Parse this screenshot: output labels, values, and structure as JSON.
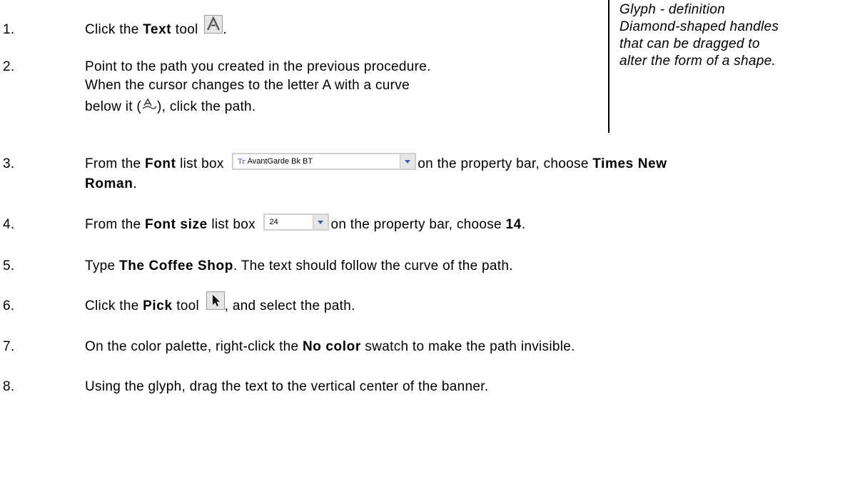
{
  "sidebar": {
    "line1": "Glyph - definition",
    "line2": "Diamond-shaped handles",
    "line3": "that can be dragged to",
    "line4": "alter the form of a shape."
  },
  "steps": [
    {
      "num": "1.",
      "pre": "Click the ",
      "bold": "Text",
      "post": " tool",
      "end": "."
    },
    {
      "num": "2.",
      "line1": "Point to the path you created in the previous procedure.",
      "line2": "When the cursor changes to the letter A with a curve",
      "line3_pre": "below it (",
      "line3_post": "), click the path."
    },
    {
      "num": "3.",
      "pre": "From the ",
      "bold": "Font",
      "mid": " list box",
      "post": "on the property bar, choose ",
      "bold2": "Times New",
      "bold3": "Roman",
      "end": "."
    },
    {
      "num": "4.",
      "pre": "From the ",
      "bold": "Font size",
      "mid": " list box",
      "post": "on the property bar, choose ",
      "bold2": "14",
      "end": "."
    },
    {
      "num": "5.",
      "pre": "Type ",
      "bold": "The Coffee Shop",
      "post": ". The text should follow the curve of the path."
    },
    {
      "num": "6.",
      "pre": "Click the ",
      "bold": "Pick",
      "post": " tool",
      "end": ", and select the path."
    },
    {
      "num": "7.",
      "pre": "On the color palette, right-click the ",
      "bold": "No color",
      "post": " swatch to make the path invisible."
    },
    {
      "num": "8.",
      "text": "Using the glyph, drag the text to the vertical center of the banner."
    }
  ],
  "font_combo": {
    "value": "AvantGarde Bk BT",
    "prefix": "Tr"
  },
  "size_combo": {
    "value": "24"
  },
  "icons": [
    "text-tool-icon",
    "text-on-path-cursor-icon",
    "pick-tool-icon",
    "dropdown-arrow-icon"
  ],
  "colors": {
    "text": "#000000",
    "accent": "#3a5aa8"
  }
}
